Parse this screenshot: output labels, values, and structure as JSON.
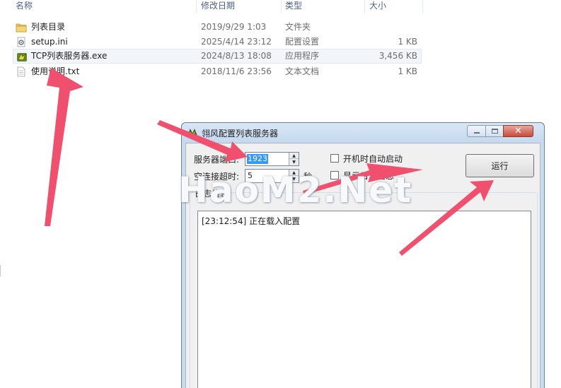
{
  "explorer": {
    "columns": {
      "name": "名称",
      "date": "修改日期",
      "type": "类型",
      "size": "大小"
    },
    "files": [
      {
        "icon": "folder-icon",
        "name": "列表目录",
        "date": "2019/9/29 1:03",
        "type": "文件夹",
        "size": ""
      },
      {
        "icon": "settings-file-icon",
        "name": "setup.ini",
        "date": "2025/4/14 23:12",
        "type": "配置设置",
        "size": "1 KB"
      },
      {
        "icon": "application-icon",
        "name": "TCP列表服务器.exe",
        "date": "2024/8/13 18:08",
        "type": "应用程序",
        "size": "3,456 KB"
      },
      {
        "icon": "text-file-icon",
        "name": "使用说明.txt",
        "date": "2018/11/6 23:56",
        "type": "文本文档",
        "size": "1 KB"
      }
    ]
  },
  "dialog": {
    "title": "翎风配置列表服务器",
    "port_label": "服务器端口:",
    "port_value": "1923",
    "timeout_label": "空连接超时:",
    "timeout_value": "5",
    "timeout_unit": "秒",
    "autostart_label": "开机时自动启动",
    "autostart_checked": false,
    "showlog_label": "显示日志信息",
    "showlog_checked": false,
    "run_button": "运行",
    "group_label": "日志信息",
    "log_lines": [
      "[23:12:54] 正在载入配置"
    ]
  },
  "watermark": "HaoM2.Net",
  "colors": {
    "annotation_arrow": "#f0506e",
    "selection": "#3399ff",
    "window_frame": "#c9dbef",
    "close_button": "#c8493a"
  }
}
